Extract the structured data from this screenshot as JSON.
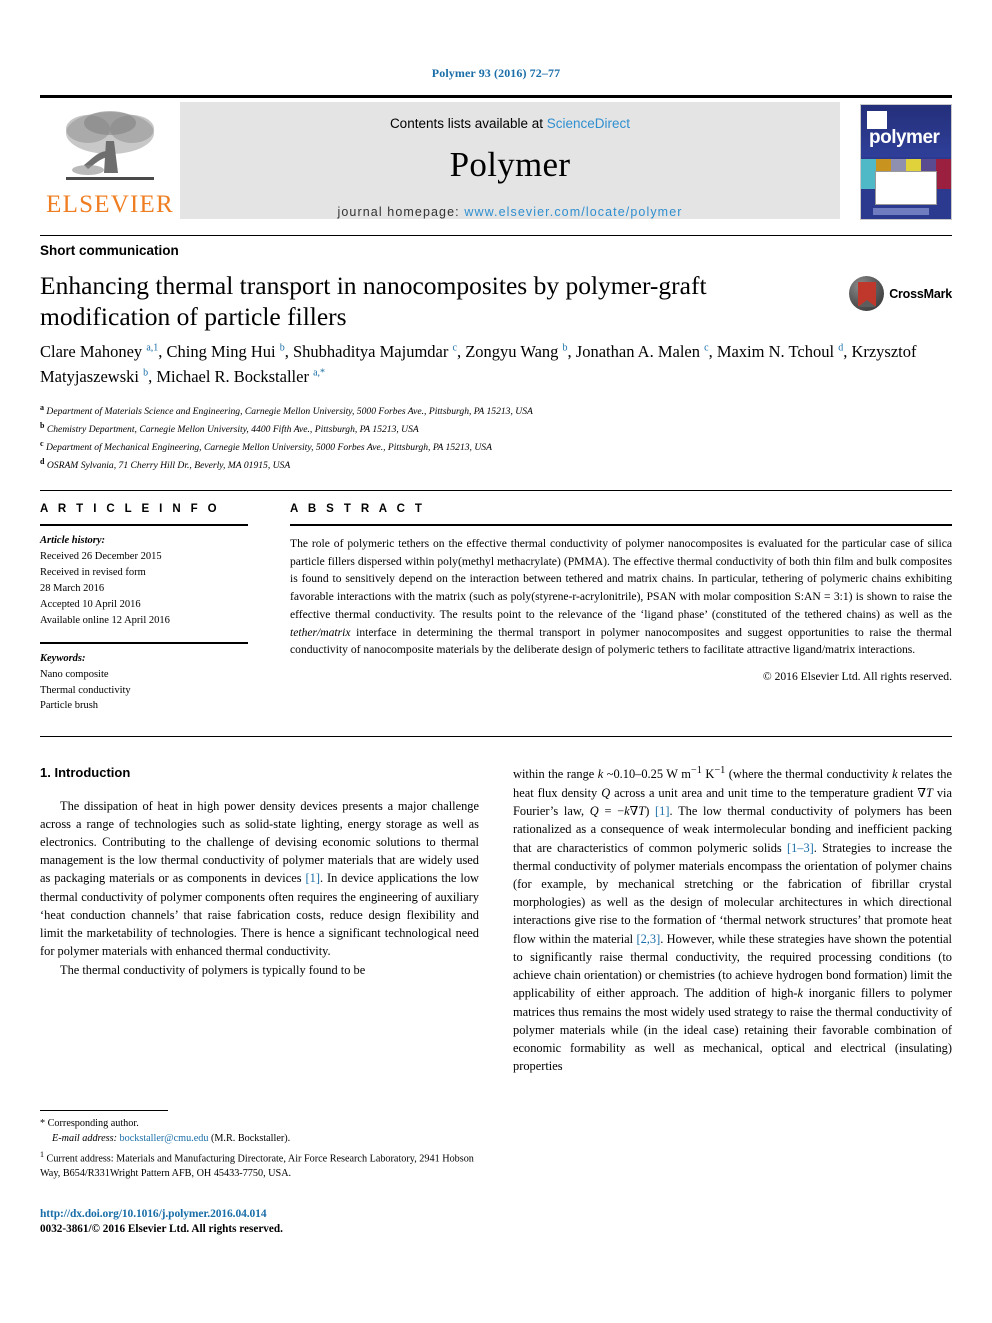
{
  "running_head": "Polymer 93 (2016) 72–77",
  "masthead": {
    "publisher_name": "ELSEVIER",
    "contents_prefix": "Contents lists available at ",
    "contents_link": "ScienceDirect",
    "journal_name": "Polymer",
    "homepage_label": "journal homepage: ",
    "homepage_url": "www.elsevier.com/locate/polymer",
    "cover_title": "polymer"
  },
  "article": {
    "type": "Short communication",
    "title": "Enhancing thermal transport in nanocomposites by polymer-graft modification of particle fillers",
    "crossmark_label": "CrossMark",
    "authors_html": "Clare Mahoney <sup>a,1</sup>, Ching Ming Hui <sup>b</sup>, Shubhaditya Majumdar <sup>c</sup>, Zongyu Wang <sup>b</sup>, Jonathan A. Malen <sup>c</sup>, Maxim N. Tchoul <sup>d</sup>, Krzysztof Matyjaszewski <sup>b</sup>, Michael R. Bockstaller <sup>a,*</sup>",
    "affiliations": [
      {
        "mark": "a",
        "text": "Department of Materials Science and Engineering, Carnegie Mellon University, 5000 Forbes Ave., Pittsburgh, PA 15213, USA"
      },
      {
        "mark": "b",
        "text": "Chemistry Department, Carnegie Mellon University, 4400 Fifth Ave., Pittsburgh, PA 15213, USA"
      },
      {
        "mark": "c",
        "text": "Department of Mechanical Engineering, Carnegie Mellon University, 5000 Forbes Ave., Pittsburgh, PA 15213, USA"
      },
      {
        "mark": "d",
        "text": "OSRAM Sylvania, 71 Cherry Hill Dr., Beverly, MA 01915, USA"
      }
    ]
  },
  "article_info": {
    "heading": "A R T I C L E  I N F O",
    "history_label": "Article history:",
    "history_lines": [
      "Received 26 December 2015",
      "Received in revised form",
      "28 March 2016",
      "Accepted 10 April 2016",
      "Available online 12 April 2016"
    ],
    "keywords_label": "Keywords:",
    "keywords": [
      "Nano composite",
      "Thermal conductivity",
      "Particle brush"
    ]
  },
  "abstract": {
    "heading": "A B S T R A C T",
    "text_html": "The role of polymeric tethers on the effective thermal conductivity of polymer nanocomposites is evaluated for the particular case of silica particle fillers dispersed within poly(methyl methacrylate) (PMMA). The effective thermal conductivity of both thin film and bulk composites is found to sensitively depend on the interaction between tethered and matrix chains. In particular, tethering of polymeric chains exhibiting favorable interactions with the matrix (such as poly(styrene-r-acrylonitrile), PSAN with molar composition S:AN = 3:1) is shown to raise the effective thermal conductivity. The results point to the relevance of the &lsquo;ligand phase&rsquo; (constituted of the tethered chains) as well as the <em>tether/matrix</em> interface in determining the thermal transport in polymer nanocomposites and suggest opportunities to raise the thermal conductivity of nanocomposite materials by the deliberate design of polymeric tethers to facilitate attractive ligand/matrix interactions.",
    "copyright": "© 2016 Elsevier Ltd. All rights reserved."
  },
  "body": {
    "section_number_title": "1. Introduction",
    "left_paragraphs_html": [
      "The dissipation of heat in high power density devices presents a major challenge across a range of technologies such as solid-state lighting, energy storage as well as electronics. Contributing to the challenge of devising economic solutions to thermal management is the low thermal conductivity of polymer materials that are widely used as packaging materials or as components in devices <span class=\"ref\">[1]</span>. In device applications the low thermal conductivity of polymer components often requires the engineering of auxiliary &lsquo;heat conduction channels&rsquo; that raise fabrication costs, reduce design flexibility and limit the marketability of technologies. There is hence a significant technological need for polymer materials with enhanced thermal conductivity.",
      "The thermal conductivity of polymers is typically found to be"
    ],
    "right_paragraphs_html": [
      "within the range <em>k</em> ~0.10&ndash;0.25 W m<sup>&minus;1</sup> K<sup>&minus;1</sup> (where the thermal conductivity <em>k</em> relates the heat flux density <em>Q</em> across a unit area and unit time to the temperature gradient &nabla;<em>T</em> via Fourier&rsquo;s law, <em>Q</em> = &minus;<em>k</em>&nabla;<em>T</em>) <span class=\"ref\">[1]</span>. The low thermal conductivity of polymers has been rationalized as a consequence of weak intermolecular bonding and inefficient packing that are characteristics of common polymeric solids <span class=\"ref\">[1&ndash;3]</span>. Strategies to increase the thermal conductivity of polymer materials encompass the orientation of polymer chains (for example, by mechanical stretching or the fabrication of fibrillar crystal morphologies) as well as the design of molecular architectures in which directional interactions give rise to the formation of &lsquo;thermal network structures&rsquo; that promote heat flow within the material <span class=\"ref\">[2,3]</span>. However, while these strategies have shown the potential to significantly raise thermal conductivity, the required processing conditions (to achieve chain orientation) or chemistries (to achieve hydrogen bond formation) limit the applicability of either approach. The addition of high-<em>k</em> inorganic fillers to polymer matrices thus remains the most widely used strategy to raise the thermal conductivity of polymer materials while (in the ideal case) retaining their favorable combination of economic formability as well as mechanical, optical and electrical (insulating) properties"
    ]
  },
  "footnotes": {
    "corresponding_author": "Corresponding author.",
    "email_label": "E-mail address:",
    "email": "bockstaller@cmu.edu",
    "email_suffix": "(M.R. Bockstaller).",
    "current_address": "Current address: Materials and Manufacturing Directorate, Air Force Research Laboratory, 2941 Hobson Way, B654/R331Wright Pattern AFB, OH 45433-7750, USA."
  },
  "imprint": {
    "doi": "http://dx.doi.org/10.1016/j.polymer.2016.04.014",
    "issn_line": "0032-3861/© 2016 Elsevier Ltd. All rights reserved."
  },
  "colors": {
    "link_blue": "#1a6ea8",
    "sciencedirect_blue": "#2f8fd0",
    "elsevier_orange": "#ef7d21",
    "cover_blue": "#2b3a8f"
  }
}
